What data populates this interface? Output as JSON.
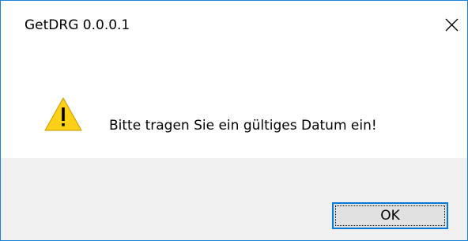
{
  "window": {
    "title": "GetDRG 0.0.0.1",
    "close_icon": "close-icon"
  },
  "message": {
    "icon": "warning-icon",
    "text": "Bitte tragen Sie ein gültiges Datum ein!"
  },
  "buttons": {
    "ok_label": "OK"
  },
  "colors": {
    "accent": "#0078d7",
    "warning_fill": "#fcd116",
    "footer_bg": "#f0f0f0"
  }
}
